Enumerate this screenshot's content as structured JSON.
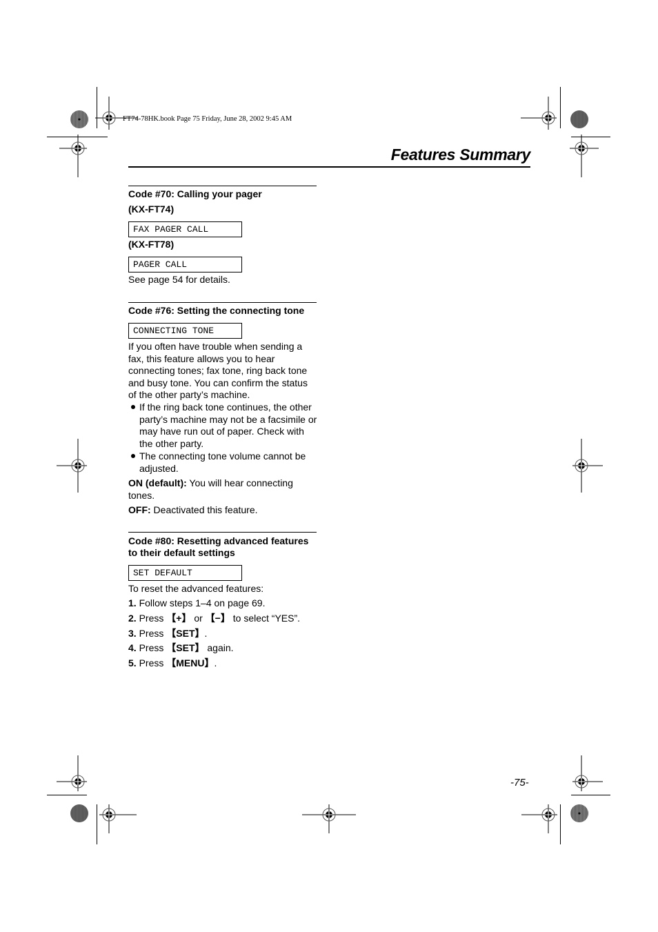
{
  "print_info": "FT74-78HK.book  Page 75  Friday, June 28, 2002  9:45 AM",
  "header": {
    "title": "Features Summary"
  },
  "sections": [
    {
      "heading": "Code #70: Calling your pager",
      "variants": [
        {
          "model": "(KX-FT74)",
          "display": "FAX PAGER CALL"
        },
        {
          "model": "(KX-FT78)",
          "display": "PAGER CALL"
        }
      ],
      "note": "See page 54 for details."
    },
    {
      "heading": "Code #76: Setting the connecting tone",
      "display": "CONNECTING TONE",
      "description": "If you often have trouble when sending a fax, this feature allows you to hear connecting tones; fax tone, ring back tone and busy tone. You can confirm the status of the other party’s machine.",
      "bullets": [
        "If the ring back tone continues, the other party’s machine may not be a facsimile or may have run out of paper. Check with the other party.",
        "The connecting tone volume cannot be adjusted."
      ],
      "options": [
        {
          "label": "ON (default):",
          "text": " You will hear connecting tones."
        },
        {
          "label": "OFF:",
          "text": " Deactivated this feature."
        }
      ]
    },
    {
      "heading_line1": "Code #80: Resetting advanced features",
      "heading_line2": "to their default settings",
      "display": "SET DEFAULT",
      "intro": "To reset the advanced features:",
      "steps": [
        {
          "num": "1.",
          "pre": " Follow steps 1–4 on page 69.",
          "key1": "",
          "mid": "",
          "key2": "",
          "post": ""
        },
        {
          "num": "2.",
          "pre": " Press ",
          "key1": "【+】",
          "mid": " or ",
          "key2": "【−】",
          "post": " to select “YES”."
        },
        {
          "num": "3.",
          "pre": " Press ",
          "key1": "【SET】",
          "mid": "",
          "key2": "",
          "post": "."
        },
        {
          "num": "4.",
          "pre": " Press ",
          "key1": "【SET】",
          "mid": "",
          "key2": "",
          "post": " again."
        },
        {
          "num": "5.",
          "pre": " Press ",
          "key1": "【MENU】",
          "mid": "",
          "key2": "",
          "post": "."
        }
      ]
    }
  ],
  "footer": {
    "page_number": "-75-"
  },
  "icons": {
    "registration_mark": "crosshair-circle",
    "color_target": "starburst-circle"
  }
}
